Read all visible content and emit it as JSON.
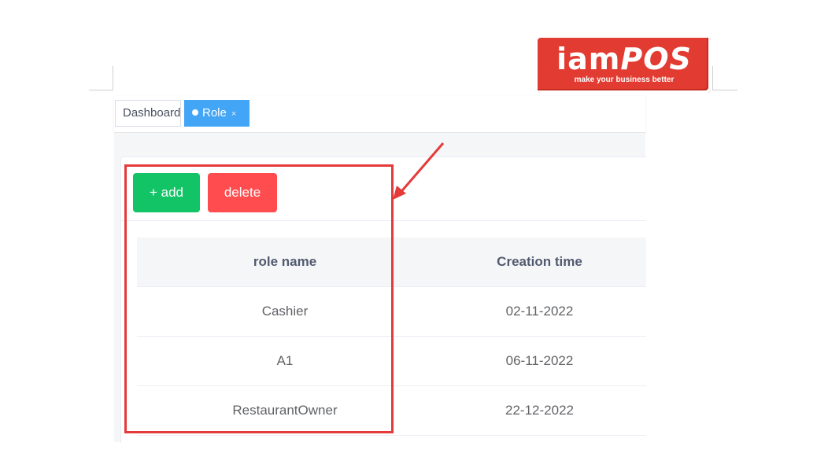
{
  "logo": {
    "brand_prefix": "iam",
    "brand_suffix": "POS",
    "tagline": "make your business better",
    "background_color": "#e23b31"
  },
  "tabs": [
    {
      "label": "Dashboard",
      "active": false
    },
    {
      "label": "Role",
      "active": true,
      "close_icon": "×"
    }
  ],
  "toolbar": {
    "add_label": "+ add",
    "delete_label": "delete",
    "add_color": "#13c466",
    "delete_color": "#ff4d4f"
  },
  "table": {
    "headers": [
      "role name",
      "Creation time"
    ],
    "rows": [
      [
        "Cashier",
        "02-11-2022"
      ],
      [
        "A1",
        "06-11-2022"
      ],
      [
        "RestaurantOwner",
        "22-12-2022"
      ]
    ]
  },
  "accent_color": "#42a5f5",
  "annotation_color": "#e43a3a"
}
